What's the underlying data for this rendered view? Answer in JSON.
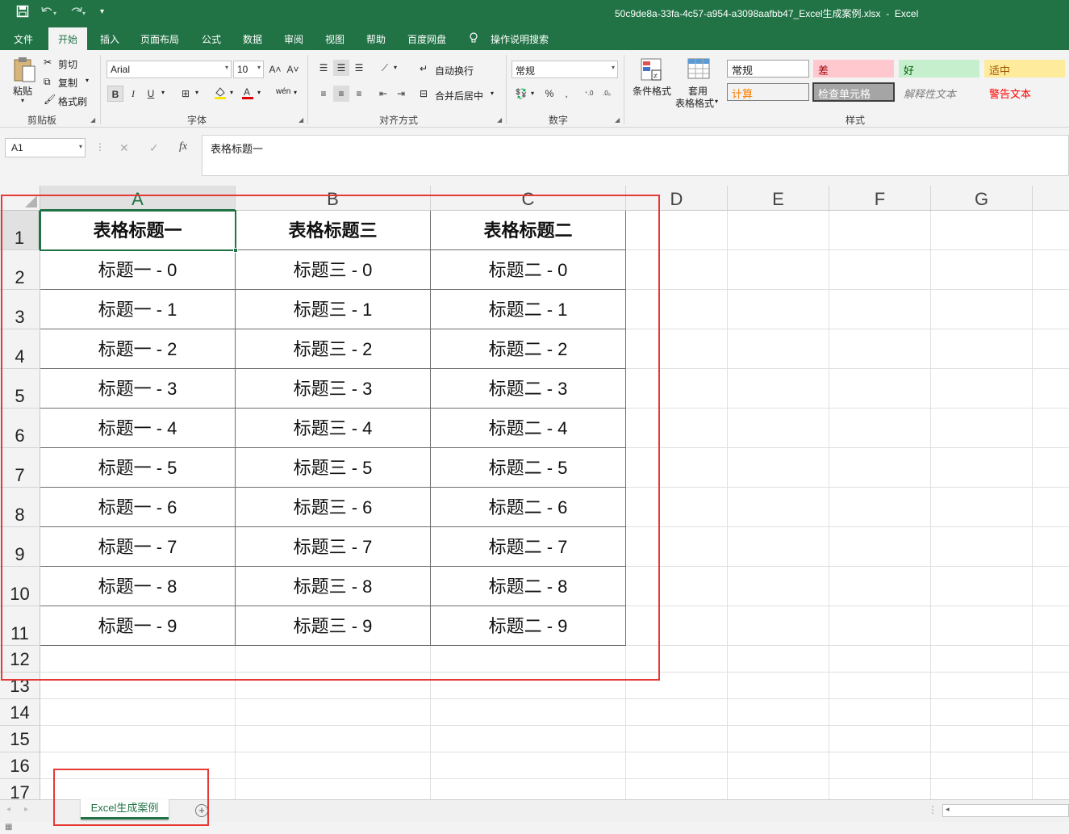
{
  "titlebar": {
    "save_icon": "save-icon",
    "undo_icon": "undo-icon",
    "redo_icon": "redo-icon",
    "customize_icon": "customize-icon",
    "filename": "50c9de8a-33fa-4c57-a954-a3098aafbb47_Excel生成案例.xlsx",
    "separator": "-",
    "app": "Excel"
  },
  "tabs": [
    "文件",
    "开始",
    "插入",
    "页面布局",
    "公式",
    "数据",
    "审阅",
    "视图",
    "帮助",
    "百度网盘",
    "操作说明搜索"
  ],
  "ribbon": {
    "clipboard": {
      "paste": "粘贴",
      "cut": "剪切",
      "copy": "复制",
      "format_painter": "格式刷",
      "label": "剪贴板"
    },
    "font": {
      "name": "Arial",
      "size": "10",
      "bold": "B",
      "italic": "I",
      "underline": "U",
      "inc": "A˄",
      "dec": "A˅",
      "label": "字体",
      "wen": "wén"
    },
    "alignment": {
      "wrap": "自动换行",
      "merge": "合并后居中",
      "label": "对齐方式"
    },
    "number": {
      "format": "常规",
      "percent": "%",
      "comma": ",",
      "label": "数字"
    },
    "styles": {
      "conditional": "条件格式",
      "table_format_1": "套用",
      "table_format_2": "表格格式",
      "cells": [
        {
          "text": "常规",
          "bg": "#ffffff",
          "color": "#222222",
          "border": "#9e9e9e"
        },
        {
          "text": "差",
          "bg": "#ffc7ce",
          "color": "#9c0006",
          "border": "#ffc7ce"
        },
        {
          "text": "好",
          "bg": "#c6efce",
          "color": "#006100",
          "border": "#c6efce"
        },
        {
          "text": "适中",
          "bg": "#ffeb9c",
          "color": "#9c5700",
          "border": "#ffeb9c"
        },
        {
          "text": "计算",
          "bg": "#f2f2f2",
          "color": "#fa7d00",
          "border": "#7f7f7f"
        },
        {
          "text": "检查单元格",
          "bg": "#a5a5a5",
          "color": "#ffffff",
          "border": "#3f3f3f"
        },
        {
          "text": "解释性文本",
          "bg": "#f3f3f3",
          "color": "#7f7f7f",
          "border": "#f3f3f3"
        },
        {
          "text": "警告文本",
          "bg": "#f3f3f3",
          "color": "#ff0000",
          "border": "#f3f3f3"
        }
      ],
      "label": "样式"
    }
  },
  "formula_bar": {
    "cell_ref": "A1",
    "cancel": "✕",
    "enter": "✓",
    "fx": "fx",
    "content": "表格标题一"
  },
  "columns": [
    "A",
    "B",
    "C",
    "D",
    "E",
    "F",
    "G"
  ],
  "rows": [
    "1",
    "2",
    "3",
    "4",
    "5",
    "6",
    "7",
    "8",
    "9",
    "10",
    "11",
    "12",
    "13",
    "14",
    "15",
    "16",
    "17"
  ],
  "table": {
    "headers": [
      "表格标题一",
      "表格标题三",
      "表格标题二"
    ],
    "rows": [
      [
        "标题一 - 0",
        "标题三 - 0",
        "标题二 - 0"
      ],
      [
        "标题一 - 1",
        "标题三 - 1",
        "标题二 - 1"
      ],
      [
        "标题一 - 2",
        "标题三 - 2",
        "标题二 - 2"
      ],
      [
        "标题一 - 3",
        "标题三 - 3",
        "标题二 - 3"
      ],
      [
        "标题一 - 4",
        "标题三 - 4",
        "标题二 - 4"
      ],
      [
        "标题一 - 5",
        "标题三 - 5",
        "标题二 - 5"
      ],
      [
        "标题一 - 6",
        "标题三 - 6",
        "标题二 - 6"
      ],
      [
        "标题一 - 7",
        "标题三 - 7",
        "标题二 - 7"
      ],
      [
        "标题一 - 8",
        "标题三 - 8",
        "标题二 - 8"
      ],
      [
        "标题一 - 9",
        "标题三 - 9",
        "标题二 - 9"
      ]
    ]
  },
  "sheets": {
    "active": "Excel生成案例",
    "add": "+"
  },
  "colors": {
    "excel_green": "#217346",
    "annotation_red": "#e53935",
    "selection_green": "#217346"
  }
}
